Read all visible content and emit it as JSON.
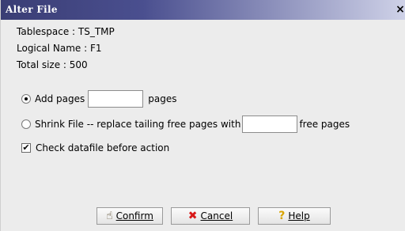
{
  "window": {
    "title": "Alter File",
    "close_label": "×"
  },
  "info": {
    "tablespace": "Tablespace : TS_TMP",
    "logical_name": "Logical Name : F1",
    "total_size": "Total size : 500"
  },
  "options": {
    "add_pages": {
      "label": "Add pages",
      "value": "",
      "suffix": "pages",
      "selected": true
    },
    "shrink_file": {
      "label": "Shrink File -- replace tailing free pages with",
      "value": "",
      "suffix": "free pages",
      "selected": false
    },
    "check_datafile": {
      "label": "Check datafile before action",
      "checked": true,
      "check_mark": "✔"
    }
  },
  "buttons": {
    "confirm": {
      "label": "Confirm",
      "icon": "pointing-hand-icon",
      "glyph": "☝"
    },
    "cancel": {
      "label": "Cancel",
      "icon": "red-x-icon",
      "glyph": "✖"
    },
    "help": {
      "label": "Help",
      "icon": "question-mark-icon",
      "glyph": "?"
    }
  }
}
